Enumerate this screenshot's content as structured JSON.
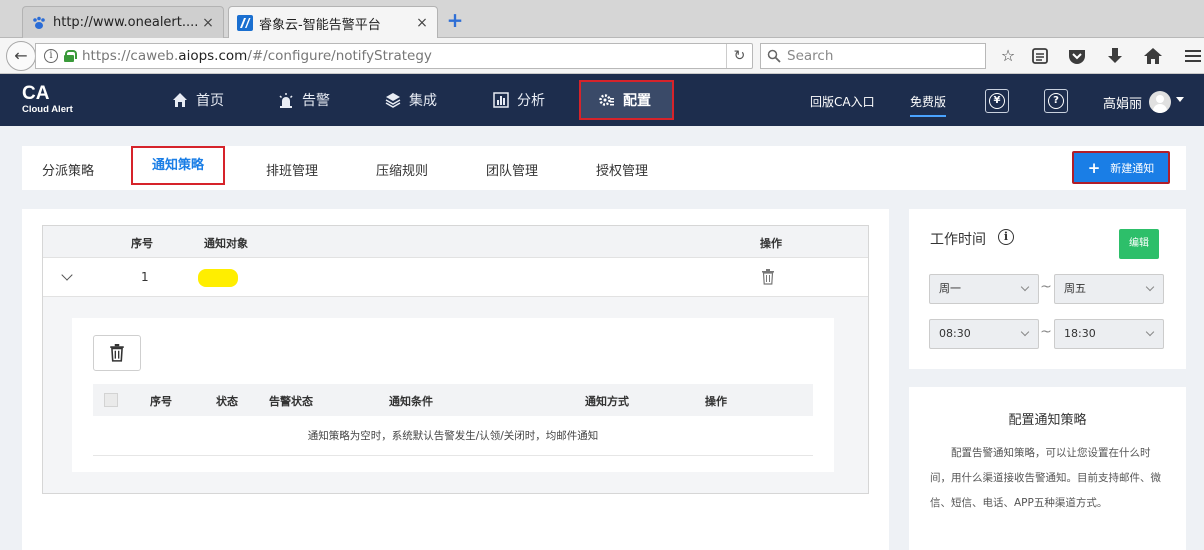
{
  "browser": {
    "tabs": [
      {
        "title": "http://www.onealert....",
        "favicon": "paw-icon",
        "active": false
      },
      {
        "title": "睿象云-智能告警平台",
        "favicon": "aiops-icon",
        "active": true
      }
    ],
    "url_prefix": "https://caweb.",
    "url_domain": "aiops.com",
    "url_path": "/#/configure/notifyStrategy",
    "search_placeholder": "Search"
  },
  "header": {
    "logo_big": "CA",
    "logo_small": "Cloud Alert",
    "nav": [
      {
        "label": "首页",
        "icon": "home-icon"
      },
      {
        "label": "告警",
        "icon": "alarm-icon"
      },
      {
        "label": "集成",
        "icon": "layers-icon"
      },
      {
        "label": "分析",
        "icon": "chart-icon"
      },
      {
        "label": "配置",
        "icon": "gear-icon",
        "active": true
      }
    ],
    "old_version": "回版CA入口",
    "free_version": "免费版",
    "username": "高娟丽"
  },
  "subnav": {
    "tabs": [
      "分派策略",
      "通知策略",
      "排班管理",
      "压缩规则",
      "团队管理",
      "授权管理"
    ],
    "active": "通知策略",
    "new_button": "新建通知"
  },
  "strategy_table": {
    "columns": [
      "序号",
      "通知对象",
      "操作"
    ],
    "rows": [
      {
        "index": "1"
      }
    ],
    "inner_columns": [
      "序号",
      "状态",
      "告警状态",
      "通知条件",
      "通知方式",
      "操作"
    ],
    "empty_note": "通知策略为空时，系统默认告警发生/认领/关闭时，均邮件通知"
  },
  "work_time": {
    "title": "工作时间",
    "edit": "编辑",
    "day_from": "周一",
    "day_to": "周五",
    "time_from": "08:30",
    "time_to": "18:30"
  },
  "help": {
    "title": "配置通知策略",
    "text": "配置告警通知策略，可以让您设置在什么时间，用什么渠道接收告警通知。目前支持邮件、微信、短信、电话、APP五种渠道方式。"
  },
  "colors": {
    "header_bg": "#1d2d4d",
    "accent": "#1a7ee6",
    "highlight": "#d6232a",
    "edit_green": "#2dbf6a"
  }
}
